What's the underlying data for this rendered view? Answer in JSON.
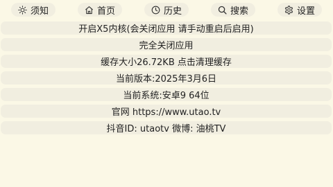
{
  "nav": {
    "tabs": [
      {
        "label": "须知",
        "icon": "sun-icon"
      },
      {
        "label": "首页",
        "icon": "home-icon"
      },
      {
        "label": "历史",
        "icon": "clock-icon"
      },
      {
        "label": "搜索",
        "icon": "search-icon"
      },
      {
        "label": "设置",
        "icon": "gear-icon"
      }
    ]
  },
  "settings": {
    "items": [
      "开启X5内核(会关闭应用 请手动重启后启用)",
      "完全关闭应用",
      "缓存大小26.72KB 点击清理缓存",
      "当前版本:2025年3月6日",
      "当前系统:安卓9 64位",
      "官网 https://www.utao.tv",
      "抖音ID: utaotv 微博: 油桃TV"
    ]
  },
  "colors": {
    "background": "#fbf8e6",
    "pill": "#f1eee0",
    "text": "#222222"
  }
}
